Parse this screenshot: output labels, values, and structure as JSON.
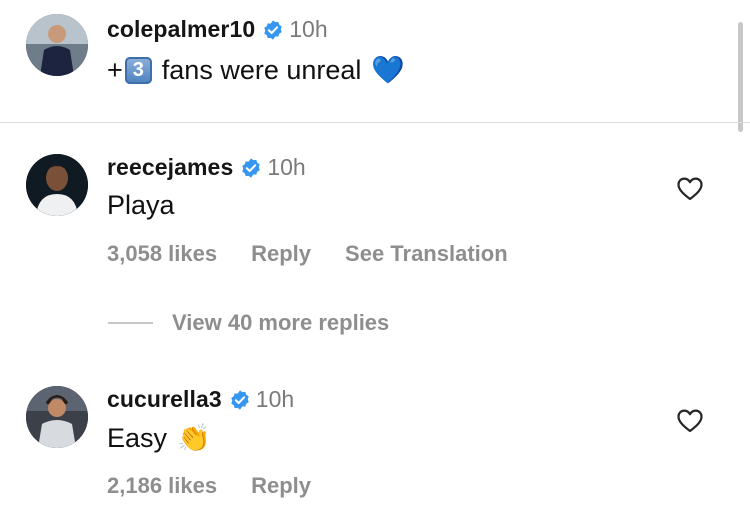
{
  "post": {
    "username": "colepalmer10",
    "time": "10h",
    "caption_plus": "+",
    "caption_keycap": "3",
    "caption_text": "fans were unreal",
    "caption_emoji": "💙"
  },
  "comments": [
    {
      "username": "reecejames",
      "time": "10h",
      "text": "Playa",
      "likes": "3,058 likes",
      "reply": "Reply",
      "translate": "See Translation"
    },
    {
      "username": "cucurella3",
      "time": "10h",
      "text": "Easy",
      "emoji": "👏",
      "likes": "2,186 likes",
      "reply": "Reply"
    }
  ],
  "view_more": "View 40 more replies",
  "colors": {
    "verified": "#3797f0",
    "meta": "#8e8e8e",
    "heart": "#262626",
    "divider": "#dbdbdb"
  }
}
